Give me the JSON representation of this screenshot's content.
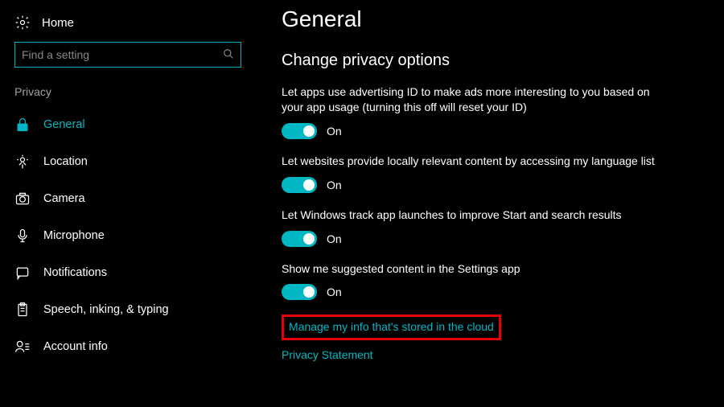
{
  "home_label": "Home",
  "search_placeholder": "Find a setting",
  "sidebar_section": "Privacy",
  "nav": [
    {
      "label": "General",
      "icon": "lock",
      "active": true
    },
    {
      "label": "Location",
      "icon": "location",
      "active": false
    },
    {
      "label": "Camera",
      "icon": "camera",
      "active": false
    },
    {
      "label": "Microphone",
      "icon": "microphone",
      "active": false
    },
    {
      "label": "Notifications",
      "icon": "notifications",
      "active": false
    },
    {
      "label": "Speech, inking, & typing",
      "icon": "speech",
      "active": false
    },
    {
      "label": "Account info",
      "icon": "account",
      "active": false
    }
  ],
  "page_title": "General",
  "section_heading": "Change privacy options",
  "options": [
    {
      "desc": "Let apps use advertising ID to make ads more interesting to you based on your app usage (turning this off will reset your ID)",
      "state": "On"
    },
    {
      "desc": "Let websites provide locally relevant content by accessing my language list",
      "state": "On"
    },
    {
      "desc": "Let Windows track app launches to improve Start and search results",
      "state": "On"
    },
    {
      "desc": "Show me suggested content in the Settings app",
      "state": "On"
    }
  ],
  "links": {
    "cloud": "Manage my info that's stored in the cloud",
    "privacy": "Privacy Statement"
  }
}
